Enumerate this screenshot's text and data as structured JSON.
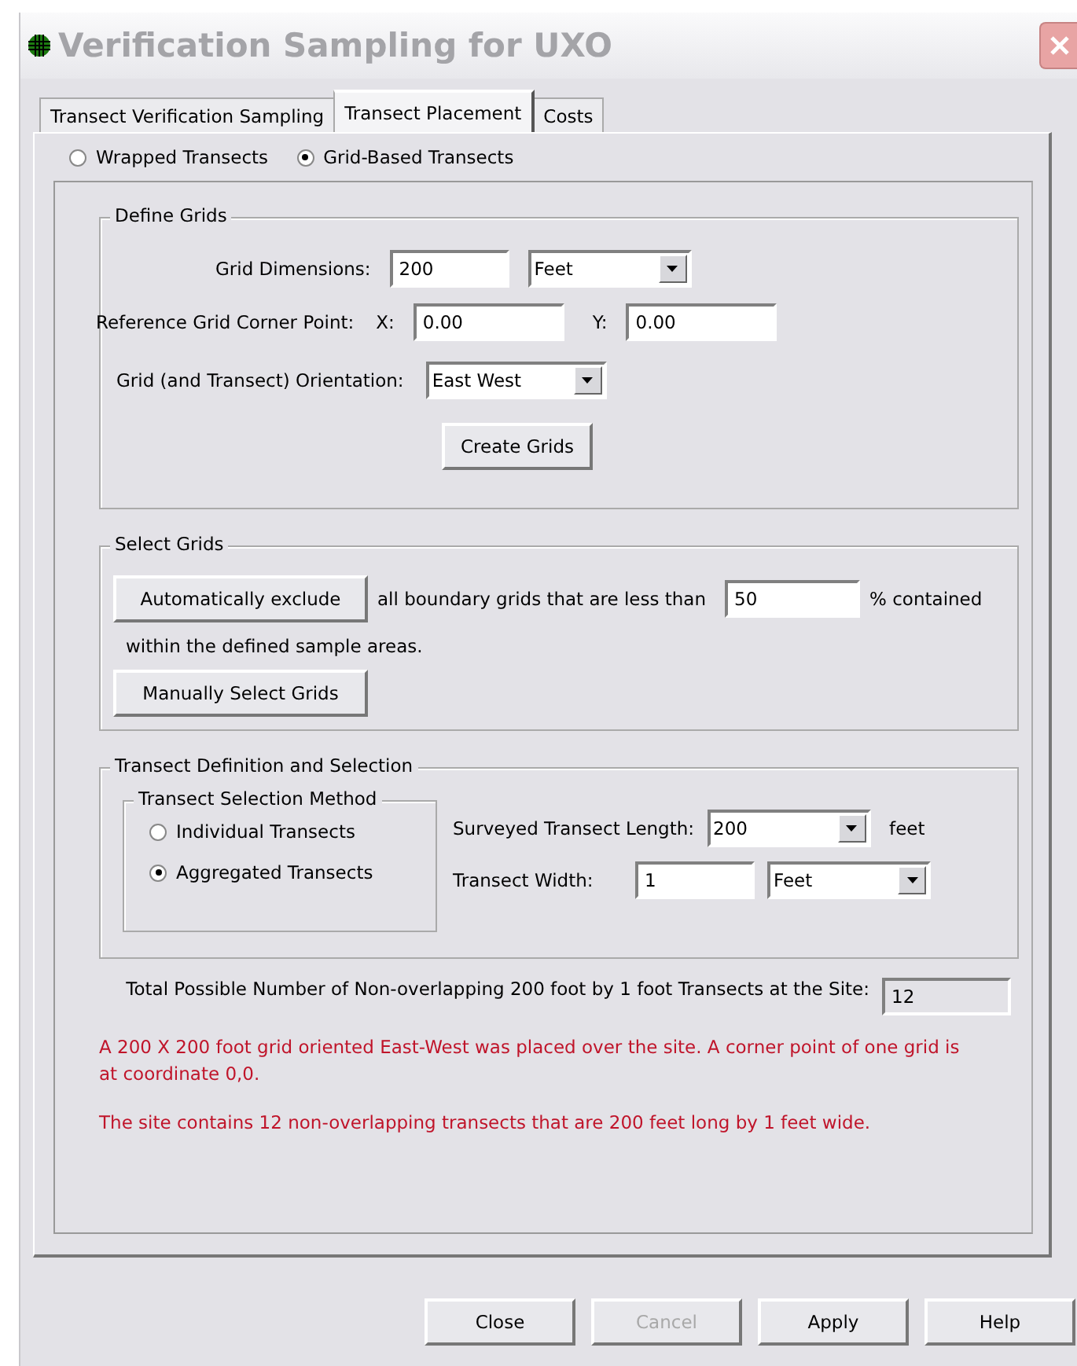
{
  "window": {
    "title": "Verification Sampling for UXO"
  },
  "tabs": [
    {
      "label": "Transect Verification Sampling",
      "selected": false
    },
    {
      "label": "Transect Placement",
      "selected": true
    },
    {
      "label": "Costs",
      "selected": false
    }
  ],
  "mode_options": [
    {
      "label": "Wrapped Transects",
      "selected": false
    },
    {
      "label": "Grid-Based Transects",
      "selected": true
    }
  ],
  "define_grids": {
    "title": "Define Grids",
    "grid_dimensions": {
      "label": "Grid Dimensions:",
      "value": "200",
      "unit": "Feet"
    },
    "corner_point": {
      "label": "Reference Grid Corner Point:",
      "x_label": "X:",
      "x_value": "0.00",
      "y_label": "Y:",
      "y_value": "0.00"
    },
    "orientation": {
      "label": "Grid (and Transect) Orientation:",
      "value": "East West"
    },
    "create_button": "Create Grids"
  },
  "select_grids": {
    "title": "Select Grids",
    "auto_button": "Automatically exclude",
    "auto_text": "all boundary grids that are less than",
    "percent_value": "50",
    "percent_text": "% contained",
    "continuation": "within the defined sample areas.",
    "manual_button": "Manually Select Grids"
  },
  "transect_definition": {
    "title": "Transect Definition and Selection",
    "method": {
      "title": "Transect Selection Method",
      "options": [
        {
          "label": "Individual Transects",
          "selected": false
        },
        {
          "label": "Aggregated Transects",
          "selected": true
        }
      ]
    },
    "length": {
      "label": "Surveyed Transect Length:",
      "value": "200",
      "unit": "feet"
    },
    "width": {
      "label": "Transect Width:",
      "value": "1",
      "unit": "Feet"
    }
  },
  "total": {
    "label": "Total Possible Number of Non-overlapping 200 foot by 1 foot Transects at the Site:",
    "value": "12"
  },
  "messages": [
    "A 200 X 200 foot grid oriented East-West was placed over the site.  A corner point of one grid is at coordinate 0,0.",
    "The site contains 12 non-overlapping transects that are 200 feet long by 1 feet wide."
  ],
  "buttons": [
    {
      "label": "Close",
      "disabled": false
    },
    {
      "label": "Cancel",
      "disabled": true
    },
    {
      "label": "Apply",
      "disabled": false
    },
    {
      "label": "Help",
      "disabled": false
    }
  ]
}
